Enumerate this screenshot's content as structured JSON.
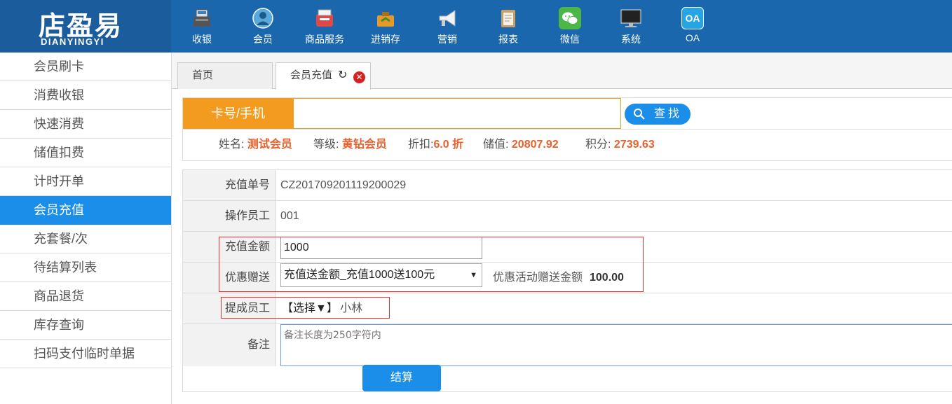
{
  "brand": {
    "name": "店盈易",
    "sub": "DIANYINGYI"
  },
  "nav": [
    {
      "label": "收银",
      "icon": "cash-register-icon",
      "color": "#4a4a4a"
    },
    {
      "label": "会员",
      "icon": "member-icon",
      "color": "#3a8fc8"
    },
    {
      "label": "商品服务",
      "icon": "goods-icon",
      "color": "#e04848"
    },
    {
      "label": "进销存",
      "icon": "inventory-icon",
      "color": "#e39a2a"
    },
    {
      "label": "营销",
      "icon": "megaphone-icon",
      "color": "#eeeeee"
    },
    {
      "label": "报表",
      "icon": "report-icon",
      "color": "#c9a06a"
    },
    {
      "label": "微信",
      "icon": "wechat-icon",
      "color": "#4cb748"
    },
    {
      "label": "系统",
      "icon": "monitor-icon",
      "color": "#333333"
    },
    {
      "label": "OA",
      "icon": "oa-icon",
      "color": "#25a4e6",
      "icon_text": "OA"
    }
  ],
  "sidebar": {
    "items": [
      {
        "label": "会员刷卡"
      },
      {
        "label": "消费收银"
      },
      {
        "label": "快速消费"
      },
      {
        "label": "储值扣费"
      },
      {
        "label": "计时开单"
      },
      {
        "label": "会员充值",
        "active": true
      },
      {
        "label": "充套餐/次"
      },
      {
        "label": "待结算列表"
      },
      {
        "label": "商品退货"
      },
      {
        "label": "库存查询"
      },
      {
        "label": "扫码支付临时单据"
      }
    ]
  },
  "tabs": {
    "home": "首页",
    "current": "会员充值"
  },
  "search": {
    "label": "卡号/手机",
    "value": "",
    "button": "查找"
  },
  "member": {
    "name_label": "姓名:",
    "name": "测试会员",
    "level_label": "等级:",
    "level": "黄钻会员",
    "discount_label": "折扣:",
    "discount": "6.0 折",
    "balance_label": "储值:",
    "balance": "20807.92",
    "points_label": "积分:",
    "points": "2739.63"
  },
  "form": {
    "order_label": "充值单号",
    "order_no": "CZ201709201119200029",
    "operator_label": "操作员工",
    "operator": "001",
    "amount_label": "充值金额",
    "amount": "1000",
    "promo_label": "优惠赠送",
    "promo_selected": "充值送金额_充值1000送100元",
    "bonus_label": "优惠活动赠送金额",
    "bonus_value": "100.00",
    "staff_label": "提成员工",
    "staff_select": "【选择▼】",
    "staff_name": "小林",
    "remark_label": "备注",
    "remark_placeholder": "备注长度为250字符内",
    "submit": "结算"
  }
}
